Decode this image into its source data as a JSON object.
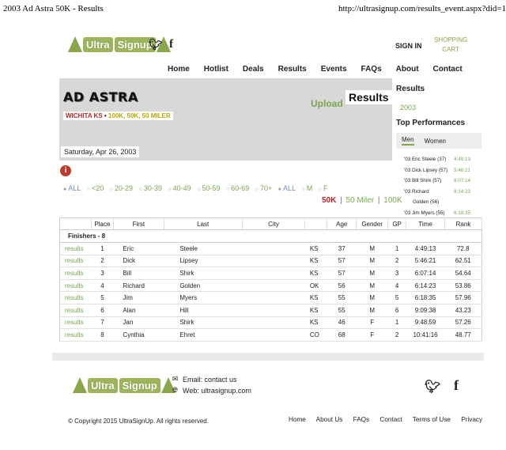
{
  "print_header": {
    "title": "2003 Ad Astra 50K - Results",
    "url": "http://ultrasignup.com/results_event.aspx?did=1678"
  },
  "logo": {
    "word1": "Ultra",
    "word2": "Signup"
  },
  "social": {
    "twitter": "twitter-icon",
    "facebook": "facebook-icon"
  },
  "account": {
    "sign_in": "SIGN IN",
    "cart_line1": "SHOPPING",
    "cart_line2": "CART"
  },
  "nav": [
    "Home",
    "Hotlist",
    "Deals",
    "Results",
    "Events",
    "FAQs",
    "About",
    "Contact"
  ],
  "event": {
    "name": "AD ASTRA",
    "location": "WICHITA KS",
    "separator": "•",
    "distances": "100K, 50K, 50 MILER",
    "upload_label": "Upload",
    "results_label": "Results",
    "date": "Saturday, Apr 26, 2003"
  },
  "filters": {
    "age": [
      "ALL",
      "<20",
      "20-29",
      "30-39",
      "40-49",
      "50-59",
      "60-69",
      "70+"
    ],
    "gender": [
      "ALL",
      "M",
      "F"
    ]
  },
  "distance_tabs": {
    "active": "50K",
    "others": [
      "50 Miler",
      "100K"
    ],
    "sep": "|"
  },
  "sidebar": {
    "results_heading": "Results",
    "year": "2003",
    "top_heading": "Top Performances",
    "tabs": [
      "Men",
      "Women"
    ],
    "performances": [
      {
        "name": "'03 Eric Steele (37)",
        "time": "4:49:13"
      },
      {
        "name": "'03 Dick Lipsey (57)",
        "time": "5:46:21"
      },
      {
        "name": "'03 Bill Shirk (57)",
        "time": "6:07:14"
      },
      {
        "name": "'03 Richard",
        "name2": "Golden (56)",
        "time": "6:14:23"
      },
      {
        "name": "'03 Jim Myers (55)",
        "time": "6:18:35"
      }
    ]
  },
  "table": {
    "headers": [
      "",
      "Place",
      "First",
      "Last",
      "City",
      "",
      "Age",
      "Gender",
      "GP",
      "Time",
      "Rank"
    ],
    "group_label": "Finishers - 8",
    "link_label": "results",
    "rows": [
      {
        "place": "1",
        "first": "Eric",
        "last": "Steele",
        "state": "KS",
        "age": "37",
        "gender": "M",
        "gp": "1",
        "time": "4:49:13",
        "rank": "72.8"
      },
      {
        "place": "2",
        "first": "Dick",
        "last": "Lipsey",
        "state": "KS",
        "age": "57",
        "gender": "M",
        "gp": "2",
        "time": "5:46:21",
        "rank": "62.51"
      },
      {
        "place": "3",
        "first": "Bill",
        "last": "Shirk",
        "state": "KS",
        "age": "57",
        "gender": "M",
        "gp": "3",
        "time": "6:07:14",
        "rank": "54.64"
      },
      {
        "place": "4",
        "first": "Richard",
        "last": "Golden",
        "state": "OK",
        "age": "56",
        "gender": "M",
        "gp": "4",
        "time": "6:14:23",
        "rank": "53.86"
      },
      {
        "place": "5",
        "first": "Jim",
        "last": "Myers",
        "state": "KS",
        "age": "55",
        "gender": "M",
        "gp": "5",
        "time": "6:18:35",
        "rank": "57.96"
      },
      {
        "place": "6",
        "first": "Alan",
        "last": "Hill",
        "state": "KS",
        "age": "55",
        "gender": "M",
        "gp": "6",
        "time": "9:09:38",
        "rank": "43.23"
      },
      {
        "place": "7",
        "first": "Jan",
        "last": "Shirk",
        "state": "KS",
        "age": "46",
        "gender": "F",
        "gp": "1",
        "time": "9:48:59",
        "rank": "57.26"
      },
      {
        "place": "8",
        "first": "Cynthia",
        "last": "Ehret",
        "state": "CO",
        "age": "68",
        "gender": "F",
        "gp": "2",
        "time": "10:41:16",
        "rank": "48.77"
      }
    ]
  },
  "footer": {
    "email": "Email: contact us",
    "web": "Web: ultrasignup.com",
    "copyright": "© Copyright 2015 UltraSignUp. All rights reserved.",
    "links": [
      "Home",
      "About Us",
      "FAQs",
      "Contact",
      "Terms of Use",
      "Privacy"
    ]
  },
  "colors": {
    "brand_green": "#8aa64a",
    "link_green": "#7aa650",
    "active_red": "#b22222"
  }
}
